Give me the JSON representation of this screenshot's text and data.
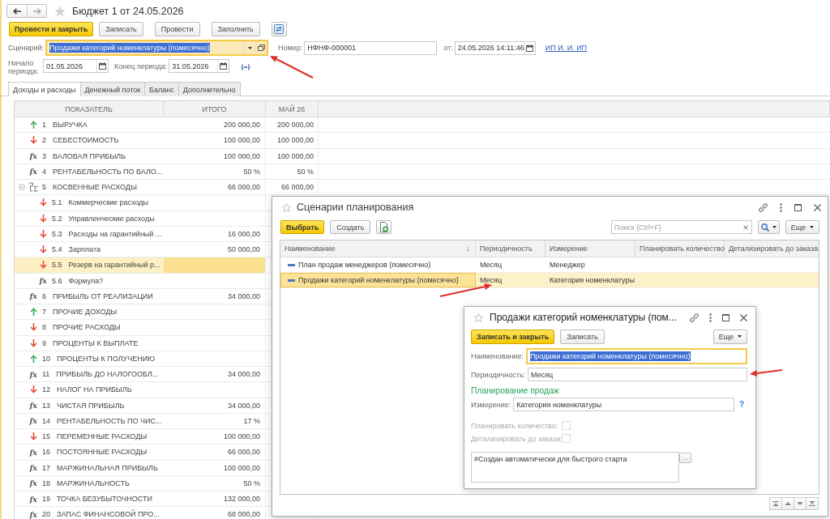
{
  "document": {
    "history": {
      "back": {
        "disabled": false
      },
      "forward": {
        "disabled": true
      }
    },
    "title": "Бюджет 1 от 24.05.2026",
    "toolbar": [
      {
        "kind": "primary",
        "label": "Провести и закрыть"
      },
      {
        "kind": "normal",
        "label": "Записать"
      },
      {
        "kind": "normal",
        "label": "Провести"
      },
      {
        "kind": "normal",
        "label": "Заполнить"
      },
      {
        "kind": "icon"
      }
    ],
    "scenario": {
      "label": "Сценарий:",
      "value": "Продажи категорий номенклатуры (помесячно)",
      "focused": true,
      "text_selected": true
    },
    "number": {
      "label": "Номер:",
      "value": "НФНФ-000001"
    },
    "date": {
      "label": "от:",
      "value": "24.05.2026 14:11:46"
    },
    "author_link": "ИП И. И. ИП",
    "period_start": {
      "label": "Начало периода:",
      "value": "01.05.2026"
    },
    "period_end": {
      "label": "Конец периода:",
      "value": "31.05.2026"
    },
    "tabs": [
      {
        "label": "Доходы и расходы",
        "selected": true
      },
      {
        "label": "Денежный поток",
        "selected": false
      },
      {
        "label": "Баланс",
        "selected": false
      },
      {
        "label": "Дополнительно",
        "selected": false
      }
    ],
    "table": {
      "columns": [
        "ПОКАЗАТЕЛЬ",
        "ИТОГО",
        "МАЙ 26"
      ],
      "rows": [
        {
          "kind": "income",
          "number": "1",
          "name": "ВЫРУЧКА",
          "total": "200 000,00",
          "month": "200 000,00",
          "selected": false
        },
        {
          "kind": "expense",
          "number": "2",
          "name": "СЕБЕСТОИМОСТЬ",
          "total": "100 000,00",
          "month": "100 000,00",
          "selected": false
        },
        {
          "kind": "formula",
          "symbol": "fx",
          "number": "3",
          "name": "ВАЛОВАЯ ПРИБЫЛЬ",
          "total": "100 000,00",
          "month": "100 000,00",
          "selected": false
        },
        {
          "kind": "formula",
          "symbol": "fx",
          "number": "4",
          "name": "РЕНТАБЕЛЬНОСТЬ ПО ВАЛО...",
          "total": "50 %",
          "month": "50 %",
          "selected": false
        },
        {
          "kind": "group",
          "number": "5",
          "name": "КОСВЕННЫЕ РАСХОДЫ",
          "total": "66 000,00",
          "month": "66 000,00",
          "selected": false,
          "expanded": true,
          "children": [
            {
              "kind": "expense",
              "number": "5.1",
              "name": "Коммерческие расходы",
              "selected": false
            },
            {
              "kind": "expense",
              "number": "5.2",
              "name": "Управленческие расходы",
              "selected": false
            },
            {
              "kind": "expense",
              "number": "5.3",
              "name": "Расходы на гарантийный ...",
              "total": "16 000,00",
              "selected": false
            },
            {
              "kind": "expense",
              "number": "5.4",
              "name": "Зарплата",
              "total": "50 000,00",
              "selected": false
            },
            {
              "kind": "expense",
              "number": "5.5",
              "name": "Резерв на гарантийный р...",
              "selected": true
            },
            {
              "kind": "formula",
              "symbol": "fx",
              "number": "5.6",
              "name": "Формула?",
              "selected": false
            }
          ]
        },
        {
          "kind": "formula",
          "symbol": "fx",
          "number": "6",
          "name": "ПРИБЫЛЬ ОТ РЕАЛИЗАЦИИ",
          "total": "34 000,00",
          "selected": false
        },
        {
          "kind": "income",
          "number": "7",
          "name": "ПРОЧИЕ ДОХОДЫ",
          "selected": false
        },
        {
          "kind": "expense",
          "number": "8",
          "name": "ПРОЧИЕ РАСХОДЫ",
          "selected": false
        },
        {
          "kind": "expense",
          "number": "9",
          "name": "ПРОЦЕНТЫ К ВЫПЛАТЕ",
          "selected": false
        },
        {
          "kind": "income",
          "number": "10",
          "name": "ПРОЦЕНТЫ К ПОЛУЧЕНИЮ",
          "selected": false
        },
        {
          "kind": "formula",
          "symbol": "fx",
          "number": "11",
          "name": "ПРИБЫЛЬ ДО НАЛОГООБЛ...",
          "total": "34 000,00",
          "selected": false
        },
        {
          "kind": "expense",
          "number": "12",
          "name": "НАЛОГ НА ПРИБЫЛЬ",
          "selected": false
        },
        {
          "kind": "formula",
          "symbol": "fx",
          "number": "13",
          "name": "ЧИСТАЯ ПРИБЫЛЬ",
          "total": "34 000,00",
          "selected": false
        },
        {
          "kind": "formula",
          "symbol": "fx",
          "number": "14",
          "name": "РЕНТАБЕЛЬНОСТЬ ПО ЧИС...",
          "total": "17 %",
          "selected": false
        },
        {
          "kind": "expense",
          "number": "15",
          "name": "ПЕРЕМЕННЫЕ РАСХОДЫ",
          "total": "100 000,00",
          "selected": false
        },
        {
          "kind": "formula",
          "symbol": "fx",
          "number": "16",
          "name": "ПОСТОЯННЫЕ РАСХОДЫ",
          "total": "66 000,00",
          "selected": false
        },
        {
          "kind": "formula",
          "symbol": "fx",
          "number": "17",
          "name": "МАРЖИНАЛЬНАЯ ПРИБЫЛЬ",
          "total": "100 000,00",
          "selected": false
        },
        {
          "kind": "formula",
          "symbol": "fx",
          "number": "18",
          "name": "МАРЖИНАЛЬНОСТЬ",
          "total": "50 %",
          "selected": false
        },
        {
          "kind": "formula",
          "symbol": "fx",
          "number": "19",
          "name": "ТОЧКА БЕЗУБЫТОЧНОСТИ",
          "total": "132 000,00",
          "selected": false
        },
        {
          "kind": "formula",
          "symbol": "fx",
          "number": "20",
          "name": "ЗАПАС ФИНАНСОВОЙ ПРО...",
          "total": "68 000,00",
          "selected": false
        }
      ]
    }
  },
  "scenarios_dialog": {
    "title": "Сценарии планирования",
    "toolbar": [
      {
        "kind": "primary",
        "label": "Выбрать"
      },
      {
        "kind": "normal",
        "label": "Создать"
      },
      {
        "kind": "icon"
      }
    ],
    "search": {
      "placeholder": "Поиск (Ctrl+F)"
    },
    "more_button": "Еще",
    "table": {
      "columns": [
        {
          "label": "Наименование",
          "sort_mark": "↓"
        },
        {
          "label": "Периодичность"
        },
        {
          "label": "Измерение"
        },
        {
          "label": "Планировать количество"
        },
        {
          "label": "Детализировать до заказа"
        }
      ],
      "rows": [
        {
          "name": "План продаж менеджеров (помесячно)",
          "period": "Месяц",
          "dimension": "Менеджер",
          "selected": false
        },
        {
          "name": "Продажи категорий номенклатуры (помесячно)",
          "period": "Месяц",
          "dimension": "Категория номенклатуры",
          "selected": true
        }
      ]
    }
  },
  "scenario_dialog": {
    "title": "Продажи категорий номенклатуры (пом...",
    "toolbar": [
      {
        "kind": "primary",
        "label": "Записать и закрыть"
      },
      {
        "kind": "normal",
        "label": "Записать"
      }
    ],
    "more_button": "Еще",
    "fields": [
      {
        "kind": "text",
        "label": "Наименование:",
        "value": "Продажи категорий номенклатуры (помесячно)",
        "focused": true,
        "text_selected": true
      },
      {
        "kind": "text",
        "label": "Периодичность:",
        "value": "Месяц",
        "focused": false,
        "text_selected": false
      },
      {
        "kind": "heading",
        "label": "Планирование продаж"
      },
      {
        "kind": "text",
        "label": "Измерение:",
        "value": "Категория номенклатуры",
        "focused": false,
        "text_selected": false,
        "help": "?"
      },
      {
        "kind": "checkbox",
        "label": "Планировать количество:",
        "checked": false,
        "disabled": true
      },
      {
        "kind": "checkbox",
        "label": "Детализировать до заказа:",
        "checked": false,
        "disabled": true
      },
      {
        "kind": "memo",
        "value": "#Создан автоматически для быстрого старта",
        "button": "..."
      }
    ]
  }
}
